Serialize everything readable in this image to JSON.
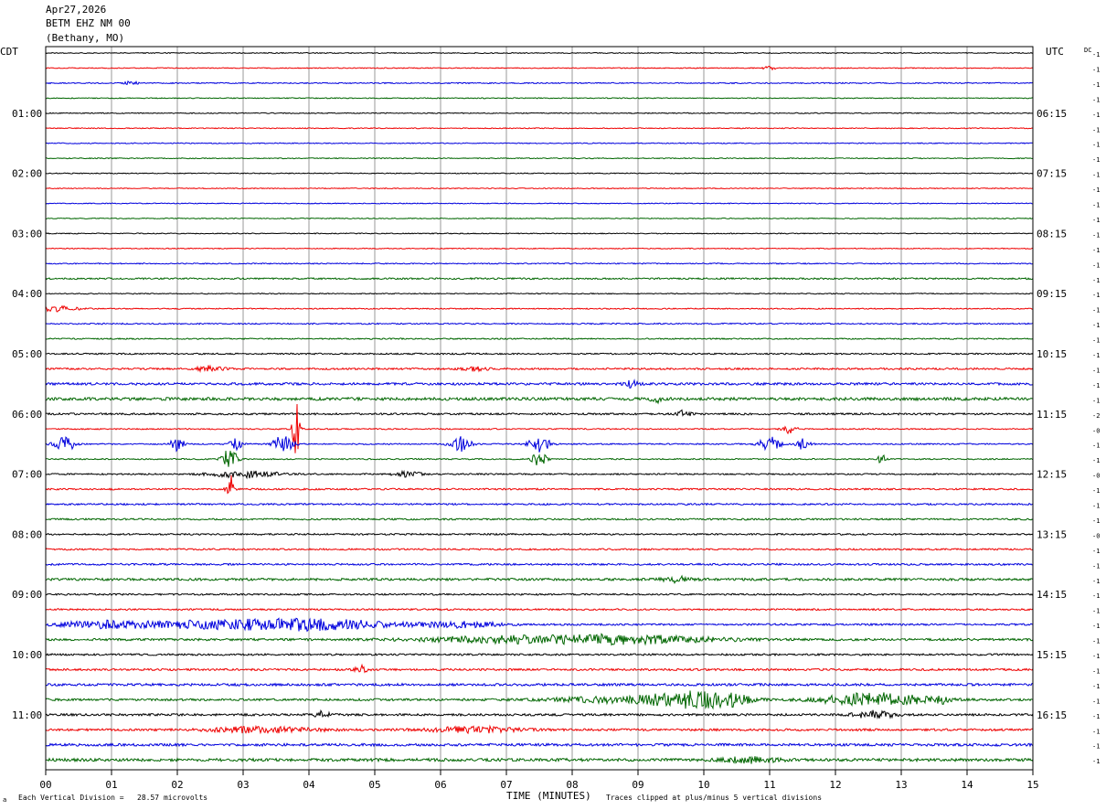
{
  "header": {
    "date": "Apr27,2026",
    "station": "BETM EHZ NM 00",
    "location": "(Bethany, MO)"
  },
  "labels": {
    "left_timezone": "CDT",
    "right_timezone": "UTC",
    "dc_label": "DC",
    "xlabel": "TIME (MINUTES)",
    "scale_note": "Each Vertical Division =   28.57 microvolts",
    "clip_note": "Traces clipped at plus/minus 5 vertical divisions"
  },
  "colors": {
    "trace_cycle": [
      "#000000",
      "#ee0000",
      "#0000dd",
      "#006600"
    ],
    "grid": "#999999",
    "frame": "#000000"
  },
  "chart_data": {
    "type": "line",
    "title": "Apr27,2026 BETM EHZ NM 00 (Bethany, MO)",
    "xlabel": "TIME (MINUTES)",
    "ylabel": "",
    "xlim": [
      0,
      15
    ],
    "x_ticks": [
      "00",
      "01",
      "02",
      "03",
      "04",
      "05",
      "06",
      "07",
      "08",
      "09",
      "10",
      "11",
      "12",
      "13",
      "14",
      "15"
    ],
    "grid": true,
    "rows_per_hour": 4,
    "minutes_per_row": 15,
    "row_count": 48,
    "left_hour_labels": [
      "01:00",
      "02:00",
      "03:00",
      "04:00",
      "05:00",
      "06:00",
      "07:00",
      "08:00",
      "09:00",
      "10:00",
      "11:00"
    ],
    "right_hour_labels": [
      "06:15",
      "07:15",
      "08:15",
      "09:15",
      "10:15",
      "11:15",
      "12:15",
      "13:15",
      "14:15",
      "15:15",
      "16:15"
    ],
    "dc_offsets": [
      "-1",
      "-1",
      "-1",
      "-1",
      "-1",
      "-1",
      "-1",
      "-1",
      "-1",
      "-1",
      "-1",
      "-1",
      "-1",
      "-1",
      "-1",
      "-1",
      "-1",
      "-1",
      "-1",
      "-1",
      "-1",
      "-1",
      "-1",
      "-1",
      "-2",
      "-0",
      "-1",
      "-1",
      "-0",
      "-1",
      "-1",
      "-1",
      "-0",
      "-1",
      "-1",
      "-1",
      "-1",
      "-1",
      "-1",
      "-1",
      "-1",
      "-1",
      "-1",
      "-1",
      "-1",
      "-1",
      "-1",
      "-1"
    ],
    "noise_level": [
      0.5,
      0.5,
      0.6,
      0.5,
      0.5,
      0.5,
      0.5,
      0.5,
      0.5,
      0.5,
      0.5,
      0.5,
      0.5,
      0.5,
      0.6,
      0.9,
      0.5,
      0.6,
      0.7,
      0.7,
      0.8,
      1.0,
      1.3,
      1.6,
      1.0,
      0.7,
      0.7,
      0.7,
      0.8,
      0.9,
      0.9,
      0.9,
      0.9,
      0.9,
      1.0,
      1.3,
      0.9,
      0.9,
      1.0,
      1.2,
      1.0,
      1.1,
      1.3,
      1.2,
      1.2,
      1.2,
      1.4,
      1.6
    ],
    "events": [
      {
        "row": 1,
        "minute": 11.0,
        "amplitude": 2,
        "duration": 0.1
      },
      {
        "row": 2,
        "minute": 1.3,
        "amplitude": 2,
        "duration": 0.1
      },
      {
        "row": 17,
        "minute": 0.2,
        "amplitude": 3,
        "duration": 0.3
      },
      {
        "row": 21,
        "minute": 2.5,
        "amplitude": 3,
        "duration": 0.2
      },
      {
        "row": 21,
        "minute": 6.5,
        "amplitude": 2,
        "duration": 0.2
      },
      {
        "row": 22,
        "minute": 8.9,
        "amplitude": 4,
        "duration": 0.1
      },
      {
        "row": 23,
        "minute": 9.3,
        "amplitude": 3,
        "duration": 0.1
      },
      {
        "row": 24,
        "minute": 9.7,
        "amplitude": 4,
        "duration": 0.1
      },
      {
        "row": 25,
        "minute": 3.8,
        "amplitude": 34,
        "duration": 0.05
      },
      {
        "row": 25,
        "minute": 11.3,
        "amplitude": 5,
        "duration": 0.1
      },
      {
        "row": 26,
        "minute": 0.3,
        "amplitude": 8,
        "duration": 0.15
      },
      {
        "row": 26,
        "minute": 2.0,
        "amplitude": 8,
        "duration": 0.1
      },
      {
        "row": 26,
        "minute": 2.9,
        "amplitude": 6,
        "duration": 0.1
      },
      {
        "row": 26,
        "minute": 3.6,
        "amplitude": 9,
        "duration": 0.15
      },
      {
        "row": 26,
        "minute": 6.3,
        "amplitude": 8,
        "duration": 0.15
      },
      {
        "row": 26,
        "minute": 7.5,
        "amplitude": 10,
        "duration": 0.15
      },
      {
        "row": 26,
        "minute": 11.0,
        "amplitude": 8,
        "duration": 0.15
      },
      {
        "row": 26,
        "minute": 11.5,
        "amplitude": 6,
        "duration": 0.1
      },
      {
        "row": 27,
        "minute": 2.8,
        "amplitude": 14,
        "duration": 0.1
      },
      {
        "row": 27,
        "minute": 7.5,
        "amplitude": 8,
        "duration": 0.1
      },
      {
        "row": 27,
        "minute": 12.7,
        "amplitude": 6,
        "duration": 0.05
      },
      {
        "row": 28,
        "minute": 3.0,
        "amplitude": 4,
        "duration": 0.5
      },
      {
        "row": 28,
        "minute": 5.5,
        "amplitude": 3,
        "duration": 0.2
      },
      {
        "row": 29,
        "minute": 2.8,
        "amplitude": 18,
        "duration": 0.05
      },
      {
        "row": 35,
        "minute": 9.6,
        "amplitude": 3,
        "duration": 0.2
      },
      {
        "row": 38,
        "minute": 1.0,
        "amplitude": 4,
        "duration": 0.8
      },
      {
        "row": 38,
        "minute": 2.3,
        "amplitude": 3,
        "duration": 0.6
      },
      {
        "row": 38,
        "minute": 3.3,
        "amplitude": 4,
        "duration": 0.8
      },
      {
        "row": 38,
        "minute": 4.3,
        "amplitude": 5,
        "duration": 1.0
      },
      {
        "row": 38,
        "minute": 6.3,
        "amplitude": 3,
        "duration": 0.6
      },
      {
        "row": 39,
        "minute": 8.5,
        "amplitude": 5,
        "duration": 1.6
      },
      {
        "row": 39,
        "minute": 6.5,
        "amplitude": 2,
        "duration": 1.0
      },
      {
        "row": 41,
        "minute": 4.8,
        "amplitude": 5,
        "duration": 0.1
      },
      {
        "row": 43,
        "minute": 9.8,
        "amplitude": 8,
        "duration": 0.6
      },
      {
        "row": 43,
        "minute": 10.4,
        "amplitude": 5,
        "duration": 0.3
      },
      {
        "row": 43,
        "minute": 12.6,
        "amplitude": 7,
        "duration": 0.8
      },
      {
        "row": 43,
        "minute": 13.6,
        "amplitude": 3,
        "duration": 0.1
      },
      {
        "row": 43,
        "minute": 8.7,
        "amplitude": 3,
        "duration": 1.0
      },
      {
        "row": 44,
        "minute": 12.6,
        "amplitude": 4,
        "duration": 0.3
      },
      {
        "row": 44,
        "minute": 4.2,
        "amplitude": 4,
        "duration": 0.1
      },
      {
        "row": 45,
        "minute": 3.3,
        "amplitude": 3,
        "duration": 0.8
      },
      {
        "row": 45,
        "minute": 6.5,
        "amplitude": 3,
        "duration": 0.7
      },
      {
        "row": 47,
        "minute": 10.7,
        "amplitude": 3,
        "duration": 0.4
      }
    ]
  }
}
